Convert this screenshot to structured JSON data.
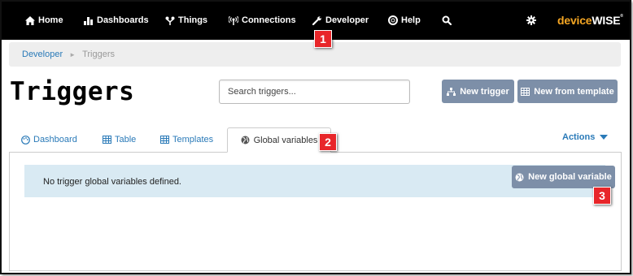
{
  "nav": {
    "items": [
      {
        "label": "Home",
        "icon": "home-icon"
      },
      {
        "label": "Dashboards",
        "icon": "bar-chart-icon"
      },
      {
        "label": "Things",
        "icon": "things-icon"
      },
      {
        "label": "Connections",
        "icon": "signal-icon"
      },
      {
        "label": "Developer",
        "icon": "wrench-icon"
      },
      {
        "label": "Help",
        "icon": "lifebuoy-icon"
      }
    ],
    "search_icon": "search-icon",
    "settings_icon": "gear-icon",
    "brand": {
      "part1": "device",
      "part2": "WISE",
      "mark": "®"
    },
    "brand_colors": {
      "device": "#f5a623",
      "wise": "#ffffff"
    }
  },
  "breadcrumb": {
    "items": [
      "Developer",
      "Triggers"
    ],
    "separator": "►"
  },
  "page": {
    "title": "Triggers",
    "search_placeholder": "Search triggers..."
  },
  "toolbar": {
    "new_trigger_label": "New trigger",
    "new_from_template_label": "New from template"
  },
  "tabs": [
    {
      "label": "Dashboard",
      "icon": "palette-icon",
      "active": false
    },
    {
      "label": "Table",
      "icon": "table-icon",
      "active": false
    },
    {
      "label": "Templates",
      "icon": "table-icon",
      "active": false
    },
    {
      "label": "Global variables",
      "icon": "globe-icon",
      "active": true
    }
  ],
  "actions": {
    "label": "Actions"
  },
  "panel": {
    "message": "No trigger global variables defined.",
    "new_global_variable_label": "New global variable"
  },
  "callouts": [
    "1",
    "2",
    "3"
  ],
  "colors": {
    "nav_bg": "#000000",
    "link": "#2a7ab8",
    "button": "#7d8fa8",
    "info_bg": "#d9eaf3",
    "callout": "#e8262a"
  }
}
